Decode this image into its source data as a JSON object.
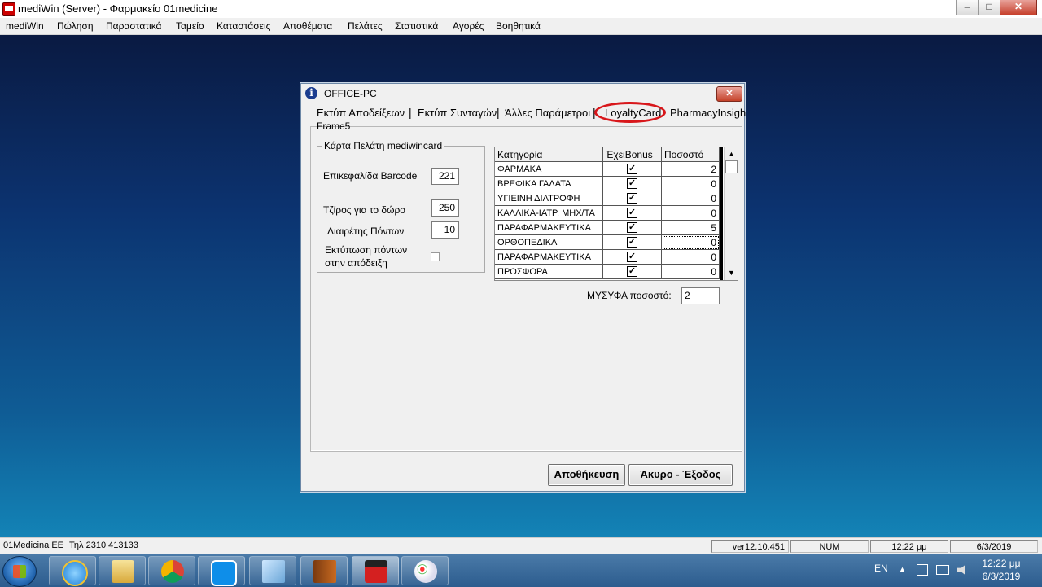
{
  "window": {
    "title": "mediWin (Server) - Φαρμακείο 01medicine",
    "min_label": "–",
    "max_label": "□",
    "close_label": "✕"
  },
  "menu": [
    "mediWin",
    "Πώληση",
    "Παραστατικά",
    "Ταμείο",
    "Καταστάσεις",
    "Αποθέματα",
    "Πελάτες",
    "Στατιστικά",
    "Αγορές",
    "Βοηθητικά"
  ],
  "dialog": {
    "title": "OFFICE-PC",
    "close_label": "✕",
    "tabs": [
      "Εκτύπ Αποδείξεων",
      "Εκτύπ Συνταγών",
      "Άλλες Παράμετροι",
      "LoyaltyCard",
      "PharmacyInsigh"
    ],
    "tab_separator": "|",
    "active_tab": "LoyaltyCard",
    "frame_label": "Frame5",
    "group": {
      "title": "Κάρτα Πελάτη mediwincard",
      "barcode_label": "Επικεφαλίδα Barcode",
      "barcode_value": "221",
      "turnover_label": "Τζίρος για το δώρο",
      "turnover_value": "250",
      "divisor_label": "Διαιρέτης Πόντων",
      "divisor_value": "10",
      "print_points_label_1": "Εκτύπωση πόντων",
      "print_points_label_2": "στην απόδειξη",
      "print_points_checked": false
    },
    "grid": {
      "headers": [
        "Κατηγορία",
        "ΈχειBonus",
        "Ποσοστό"
      ],
      "rows": [
        {
          "category": "ΦΑΡΜΑΚΑ",
          "bonus": true,
          "percent": "2"
        },
        {
          "category": "ΒΡΕΦΙΚΑ ΓΑΛΑΤΑ",
          "bonus": true,
          "percent": "0"
        },
        {
          "category": "ΥΓΙΕΙΝΗ ΔΙΑΤΡΟΦΗ",
          "bonus": true,
          "percent": "0"
        },
        {
          "category": "ΚΑΛΛΙΚΑ-ΙΑΤΡ. ΜΗΧ/ΤΑ",
          "bonus": true,
          "percent": "0"
        },
        {
          "category": "ΠΑΡΑΦΑΡΜΑΚΕΥΤΙΚΑ",
          "bonus": true,
          "percent": "5"
        },
        {
          "category": "ΟΡΘΟΠΕΔΙΚΑ",
          "bonus": true,
          "percent": "0"
        },
        {
          "category": "ΠΑΡΑΦΑΡΜΑΚΕΥΤΙΚΑ",
          "bonus": true,
          "percent": "0"
        },
        {
          "category": "ΠΡΟΣΦΟΡΑ",
          "bonus": true,
          "percent": "0"
        }
      ],
      "check_glyph": "✓",
      "scroll_up": "▲",
      "scroll_down": "▼"
    },
    "msyfa_label": "ΜΥΣΥΦΑ ποσοστό:",
    "msyfa_value": "2",
    "save_label": "Αποθήκευση",
    "cancel_label": "Άκυρο - Έξοδος"
  },
  "statusbar": {
    "company": "01Medicina EE",
    "phone": "Τηλ 2310 413133",
    "version": "ver12.10.451",
    "num": "NUM",
    "time": "12:22 μμ",
    "date": "6/3/2019"
  },
  "taskbar": {
    "apps": [
      "internet-explorer-icon",
      "file-explorer-icon",
      "chrome-icon",
      "teamviewer-icon",
      "notepad-icon",
      "network-tool-icon",
      "mediwin-icon",
      "paint-icon"
    ],
    "lang": "EN",
    "tray_up": "▲",
    "clock_time": "12:22 μμ",
    "clock_date": "6/3/2019"
  },
  "colors": {
    "highlight_oval": "#d8171b",
    "close_red": "#c6402c",
    "desktop_top": "#0a1a42",
    "desktop_bottom": "#1383b6"
  }
}
